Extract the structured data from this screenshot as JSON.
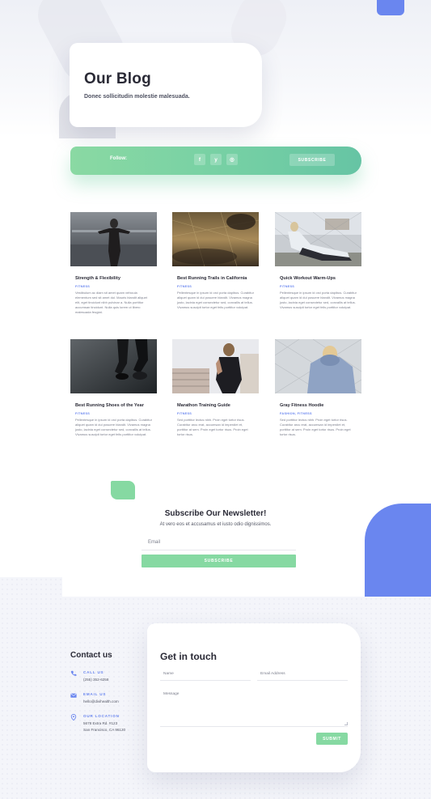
{
  "hero": {
    "title": "Our Blog",
    "subtitle": "Donec sollicitudin molestie malesuada."
  },
  "follow_bar": {
    "label": "Follow:",
    "social": [
      {
        "icon": "facebook-icon",
        "glyph": "f"
      },
      {
        "icon": "twitter-icon",
        "glyph": "y"
      },
      {
        "icon": "instagram-icon",
        "glyph": "◎"
      }
    ],
    "subscribe_label": "SUBSCRIBE"
  },
  "posts": [
    {
      "title": "Strength & Flexibility",
      "category": "FITNESS",
      "excerpt": "Vestibulum ac diam sit amet quam vehicula elementum sed sit amet dui. Mauris blandit aliquet elit, eget tincidunt nibh pulvinar a. Nulla porttitor accumsan tincidunt. Nulla quis lorem ut libero malesuada feugiat."
    },
    {
      "title": "Best Running Trails in California",
      "category": "FITNESS",
      "excerpt": "Pellentesque in ipsum id orci porta dapibus. Curabitur aliquet quam id dui posuere blandit. Vivamus magna justo, lacinia eget consectetur sed, convallis at tellus. Vivamus suscipit tortor eget felis porttitor volutpat."
    },
    {
      "title": "Quick Workout Warm-Ups",
      "category": "FITNESS",
      "excerpt": "Pellentesque in ipsum id orci porta dapibus. Curabitur aliquet quam id dui posuere blandit. Vivamus magna justo, lacinia eget consectetur sed, convallis at tellus. Vivamus suscipit tortor eget felis porttitor volutpat."
    },
    {
      "title": "Best Running Shoes of the Year",
      "category": "FITNESS",
      "excerpt": "Pellentesque in ipsum id orci porta dapibus. Curabitur aliquet quam id dui posuere blandit. Vivamus magna justo, lacinia eget consectetur sed, convallis at tellus. Vivamus suscipit tortor eget felis porttitor volutpat."
    },
    {
      "title": "Marathon Training Guide",
      "category": "FITNESS",
      "excerpt": "Sed porttitor lectus nibh. Proin eget tortor risus. Curabitur arcu erat, accumsan id imperdiet et, porttitor at sem. Proin eget tortor risus. Proin eget tortor risus."
    },
    {
      "title": "Gray Fitness Hoodie",
      "category": "FASHION, FITNESS",
      "excerpt": "Sed porttitor lectus nibh. Proin eget tortor risus. Curabitur arcu erat, accumsan id imperdiet et, porttitor at sem. Proin eget tortor risus. Proin eget tortor risus."
    }
  ],
  "newsletter": {
    "title": "Subscribe Our Newsletter!",
    "subtitle": "At vero eos et accusamus et iusto odio dignissimos.",
    "email_placeholder": "Email",
    "button_label": "SUBSCRIBE"
  },
  "contact": {
    "heading": "Contact us",
    "items": [
      {
        "icon": "phone-icon",
        "label": "CALL US",
        "lines": [
          "(255) 352-6258"
        ]
      },
      {
        "icon": "mail-icon",
        "label": "EMAIL US",
        "lines": [
          "hello@divihealth.com"
        ]
      },
      {
        "icon": "location-pin-icon",
        "label": "OUR LOCATION",
        "lines": [
          "5678 Extra Rd. #123",
          "San Francisco, CA 96120"
        ]
      }
    ]
  },
  "form": {
    "title": "Get in touch",
    "name_placeholder": "Name",
    "email_placeholder": "Email Address",
    "message_placeholder": "Message",
    "submit_label": "SUBMIT"
  },
  "colors": {
    "accent_green": "#86d9a2",
    "accent_blue": "#6a86ef",
    "text_dark": "#2a2a36"
  }
}
